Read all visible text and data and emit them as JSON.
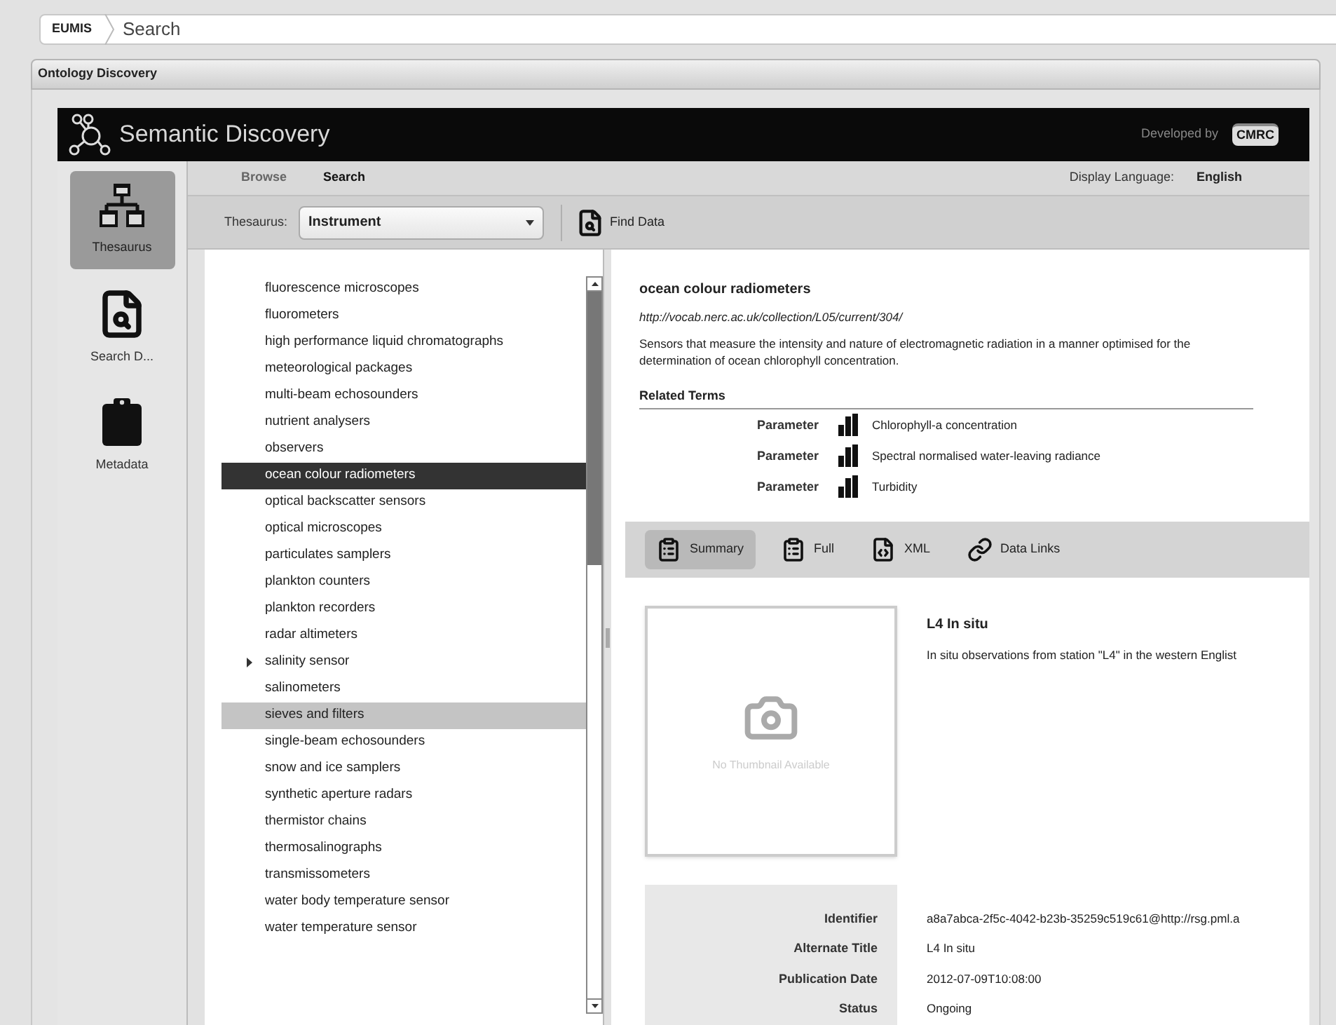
{
  "breadcrumb": {
    "root": "EUMIS",
    "current": "Search"
  },
  "panel": {
    "title": "Ontology Discovery"
  },
  "header": {
    "title": "Semantic Discovery",
    "credit": "Developed by",
    "logo_text": "CMRC"
  },
  "sidebar": {
    "items": [
      {
        "label": "Thesaurus",
        "kind": "thesaurus",
        "selected": true
      },
      {
        "label": "Search D...",
        "kind": "search",
        "selected": false
      },
      {
        "label": "Metadata",
        "kind": "metadata",
        "selected": false
      }
    ]
  },
  "nav": {
    "tabs": [
      {
        "label": "Browse",
        "selected": false
      },
      {
        "label": "Search",
        "selected": true
      }
    ],
    "language_label": "Display Language:",
    "language": "English"
  },
  "toolbar": {
    "thesaurus_label": "Thesaurus:",
    "thesaurus": "Instrument",
    "find_button": "Find Data"
  },
  "tree": {
    "items": [
      {
        "label": "fluorescence microscopes",
        "selected": false,
        "hovered": false,
        "expandable": false
      },
      {
        "label": "fluorometers",
        "selected": false,
        "hovered": false,
        "expandable": false
      },
      {
        "label": "high performance liquid chromatographs",
        "selected": false,
        "hovered": false,
        "expandable": false
      },
      {
        "label": "meteorological packages",
        "selected": false,
        "hovered": false,
        "expandable": false
      },
      {
        "label": "multi-beam echosounders",
        "selected": false,
        "hovered": false,
        "expandable": false
      },
      {
        "label": "nutrient analysers",
        "selected": false,
        "hovered": false,
        "expandable": false
      },
      {
        "label": "observers",
        "selected": false,
        "hovered": false,
        "expandable": false
      },
      {
        "label": "ocean colour radiometers",
        "selected": true,
        "hovered": false,
        "expandable": false
      },
      {
        "label": "optical backscatter sensors",
        "selected": false,
        "hovered": false,
        "expandable": false
      },
      {
        "label": "optical microscopes",
        "selected": false,
        "hovered": false,
        "expandable": false
      },
      {
        "label": "particulates samplers",
        "selected": false,
        "hovered": false,
        "expandable": false
      },
      {
        "label": "plankton counters",
        "selected": false,
        "hovered": false,
        "expandable": false
      },
      {
        "label": "plankton recorders",
        "selected": false,
        "hovered": false,
        "expandable": false
      },
      {
        "label": "radar altimeters",
        "selected": false,
        "hovered": false,
        "expandable": false
      },
      {
        "label": "salinity sensor",
        "selected": false,
        "hovered": false,
        "expandable": true
      },
      {
        "label": "salinometers",
        "selected": false,
        "hovered": false,
        "expandable": false
      },
      {
        "label": "sieves and filters",
        "selected": false,
        "hovered": true,
        "expandable": false
      },
      {
        "label": "single-beam echosounders",
        "selected": false,
        "hovered": false,
        "expandable": false
      },
      {
        "label": "snow and ice samplers",
        "selected": false,
        "hovered": false,
        "expandable": false
      },
      {
        "label": "synthetic aperture radars",
        "selected": false,
        "hovered": false,
        "expandable": false
      },
      {
        "label": "thermistor chains",
        "selected": false,
        "hovered": false,
        "expandable": false
      },
      {
        "label": "thermosalinographs",
        "selected": false,
        "hovered": false,
        "expandable": false
      },
      {
        "label": "transmissometers",
        "selected": false,
        "hovered": false,
        "expandable": false
      },
      {
        "label": "water body temperature sensor",
        "selected": false,
        "hovered": false,
        "expandable": false
      },
      {
        "label": "water temperature sensor",
        "selected": false,
        "hovered": false,
        "expandable": false
      }
    ]
  },
  "detail": {
    "title": "ocean colour radiometers",
    "url": "http://vocab.nerc.ac.uk/collection/L05/current/304/",
    "description": "Sensors that measure the intensity and nature of electromagnetic radiation in a manner optimised for the determination of ocean chlorophyll concentration.",
    "related_heading": "Related Terms",
    "related_terms": [
      {
        "type": "Parameter",
        "term": "Chlorophyll-a concentration"
      },
      {
        "type": "Parameter",
        "term": "Spectral normalised water-leaving radiance"
      },
      {
        "type": "Parameter",
        "term": "Turbidity"
      }
    ]
  },
  "result_tabs": [
    {
      "label": "Summary",
      "kind": "summary",
      "selected": true
    },
    {
      "label": "Full",
      "kind": "full",
      "selected": false
    },
    {
      "label": "XML",
      "kind": "xml",
      "selected": false
    },
    {
      "label": "Data Links",
      "kind": "links",
      "selected": false
    }
  ],
  "summary": {
    "thumbnail_text": "No Thumbnail Available",
    "title": "L4 In situ",
    "description": "In situ observations from station \"L4\" in the western Englist",
    "fields": [
      {
        "label": "Identifier",
        "value": "a8a7abca-2f5c-4042-b23b-35259c519c61@http://rsg.pml.a"
      },
      {
        "label": "Alternate Title",
        "value": "L4 In situ"
      },
      {
        "label": "Publication Date",
        "value": "2012-07-09T10:08:00"
      },
      {
        "label": "Status",
        "value": "Ongoing"
      }
    ]
  }
}
